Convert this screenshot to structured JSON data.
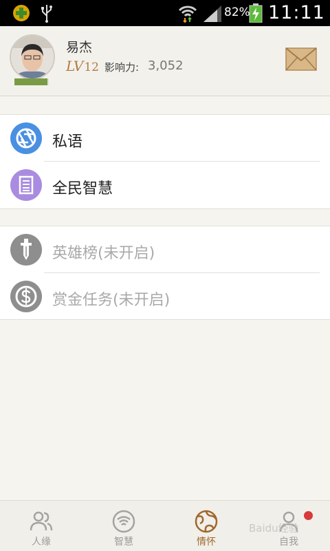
{
  "status_bar": {
    "battery_percent": "82%",
    "time": "11:11"
  },
  "profile": {
    "username": "易杰",
    "level_prefix": "LV",
    "level_number": "12",
    "influence_label": "影响力:",
    "influence_value": "3,052",
    "level_progress_fraction": 0.95
  },
  "menu_group_1": [
    {
      "label": "私语",
      "icon": "camera-aperture-icon",
      "color": "#4a90e2"
    },
    {
      "label": "全民智慧",
      "icon": "document-icon",
      "color": "#a98ce0"
    }
  ],
  "menu_group_2": [
    {
      "label": "英雄榜(未开启)",
      "icon": "sword-icon",
      "color": "#8e8e8e"
    },
    {
      "label": "赏金任务(未开启)",
      "icon": "dollar-icon",
      "color": "#8e8e8e"
    }
  ],
  "bottom_nav": [
    {
      "label": "人缘",
      "icon": "people-icon",
      "active": false
    },
    {
      "label": "智慧",
      "icon": "wifi-circle-icon",
      "active": false
    },
    {
      "label": "情怀",
      "icon": "globe-icon",
      "active": true
    },
    {
      "label": "自我",
      "icon": "person-icon",
      "active": false
    }
  ],
  "watermark_text": "Baidu经验",
  "colors": {
    "accent": "#a0672d",
    "progress": "#7a9b46",
    "badge": "#d63a3a"
  }
}
